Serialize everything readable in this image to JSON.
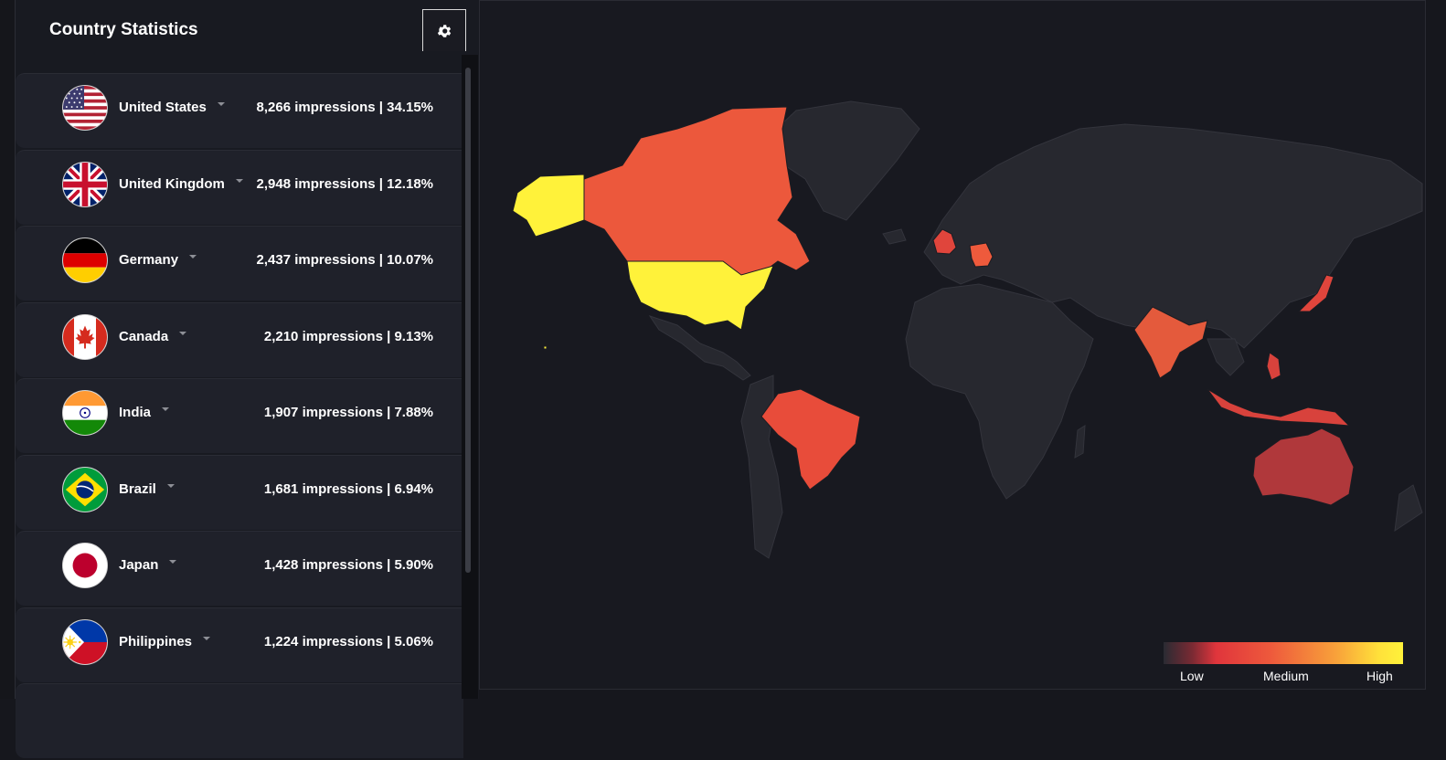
{
  "panel": {
    "title": "Country Statistics"
  },
  "countries": [
    {
      "name": "United States",
      "impressions": "8,266 impressions | 34.15%",
      "flag": "us-flag-icon"
    },
    {
      "name": "United Kingdom",
      "impressions": "2,948 impressions | 12.18%",
      "flag": "uk-flag-icon"
    },
    {
      "name": "Germany",
      "impressions": "2,437 impressions | 10.07%",
      "flag": "germany-flag-icon"
    },
    {
      "name": "Canada",
      "impressions": "2,210 impressions | 9.13%",
      "flag": "canada-flag-icon"
    },
    {
      "name": "India",
      "impressions": "1,907 impressions | 7.88%",
      "flag": "india-flag-icon"
    },
    {
      "name": "Brazil",
      "impressions": "1,681 impressions | 6.94%",
      "flag": "brazil-flag-icon"
    },
    {
      "name": "Japan",
      "impressions": "1,428 impressions | 5.90%",
      "flag": "japan-flag-icon"
    },
    {
      "name": "Philippines",
      "impressions": "1,224 impressions | 5.06%",
      "flag": "philippines-flag-icon"
    }
  ],
  "legend": {
    "low": "Low",
    "medium": "Medium",
    "high": "High"
  },
  "colors": {
    "background": "#16171d",
    "panel": "#181a21",
    "row": "#1f212a",
    "map_base": "#27282f",
    "high": "#fff23a",
    "medium": "#ec583c",
    "low_mid": "#d8423c",
    "low": "#b0383b"
  },
  "icons": {
    "settings": "gear-icon",
    "expand": "caret-down-icon"
  }
}
